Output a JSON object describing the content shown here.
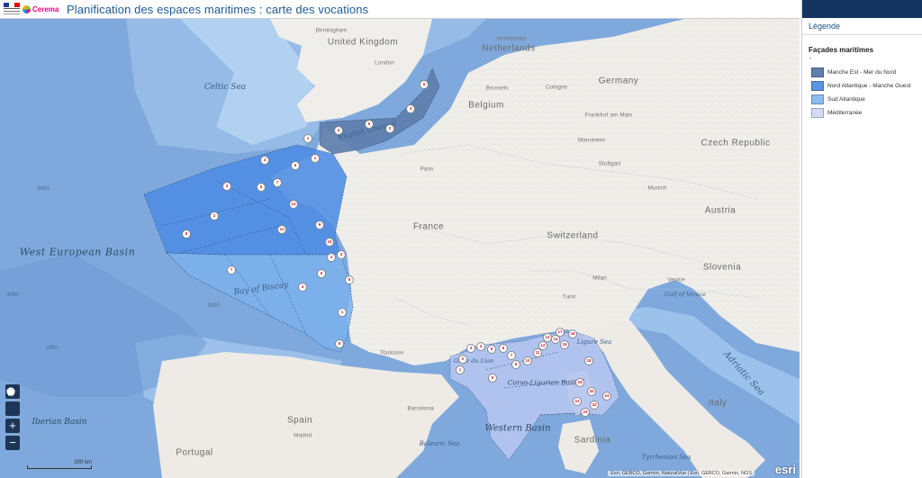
{
  "header": {
    "logos": {
      "republique": "République Française",
      "cerema": "Cerema"
    },
    "title": "Planification des espaces maritimes : carte des vocations"
  },
  "map": {
    "labels": {
      "countries": [
        "United Kingdom",
        "Netherlands",
        "Germany",
        "Belgium",
        "France",
        "Czech Republic",
        "Switzerland",
        "Austria",
        "Slovenia",
        "Italy",
        "Spain",
        "Portugal",
        "Sardinia"
      ],
      "cities": [
        "Birmingham",
        "London",
        "Amsterdam",
        "Brussels",
        "Cologne",
        "Frankfurt am Main",
        "Mannheim",
        "Stuttgart",
        "Munich",
        "Paris",
        "Toulouse",
        "Milan",
        "Venice",
        "Turin",
        "Barcelona",
        "Madrid"
      ],
      "seas": [
        "Celtic Sea",
        "English Channel",
        "Bay of Biscay",
        "Gulf of Venice",
        "Adriatic Sea",
        "Ligure Sea",
        "Golfe du Lion",
        "Balearic Sea",
        "Tyrrhenian Sea"
      ],
      "basins": [
        "West European Basin",
        "Iberian Basin",
        "Corso-Ligurian Basin",
        "Western Basin"
      ],
      "depths": [
        "5091",
        "4000",
        "2000",
        "1000"
      ]
    },
    "controls": {
      "default_extent": "Default extent",
      "home": "Home",
      "zoom_in": "+",
      "zoom_out": "−"
    },
    "scale": "200 km",
    "attribution": "Esri, GEBCO, Garmin, NaturalVue | Esri, GEBCO, Garmin, NGS",
    "esri_logo": "esri",
    "zone_numbers": {
      "manche_est": [
        "1",
        "2",
        "3",
        "4",
        "5",
        "6"
      ],
      "nord_atlantique": [
        "1",
        "2",
        "3",
        "4",
        "5",
        "6",
        "7",
        "8",
        "9",
        "10",
        "11",
        "12"
      ],
      "sud_atlantique": [
        "1",
        "2",
        "3",
        "4",
        "5",
        "6",
        "7",
        "8"
      ],
      "mediterranee": [
        "1",
        "2",
        "3",
        "4",
        "5",
        "6",
        "7",
        "8",
        "9",
        "10",
        "11",
        "12",
        "13",
        "14",
        "15",
        "16",
        "17",
        "18",
        "19",
        "20",
        "21",
        "22",
        "23",
        "24"
      ]
    },
    "colors": {
      "ocean_deep": "#7fa9dc",
      "ocean_shelf": "#a8c9ec",
      "land": "#f0eeea",
      "manche_est": "#5f7fae",
      "nord_atlantique": "#4d8de6",
      "sud_atlantique": "#7cb2ee",
      "mediterranee": "#b6c6f2"
    }
  },
  "legend": {
    "panel_title": "Légende",
    "layer_title": "Façades maritimes",
    "layer_subtitle": "-",
    "items": [
      {
        "label": "Manche Est - Mer du Nord",
        "color": "#5f7fae"
      },
      {
        "label": "Nord Atlantique - Manche Ouest",
        "color": "#5a93e0"
      },
      {
        "label": "Sud Atlantique",
        "color": "#8cbcf0"
      },
      {
        "label": "Méditerranée",
        "color": "#d3dcf6"
      }
    ]
  }
}
